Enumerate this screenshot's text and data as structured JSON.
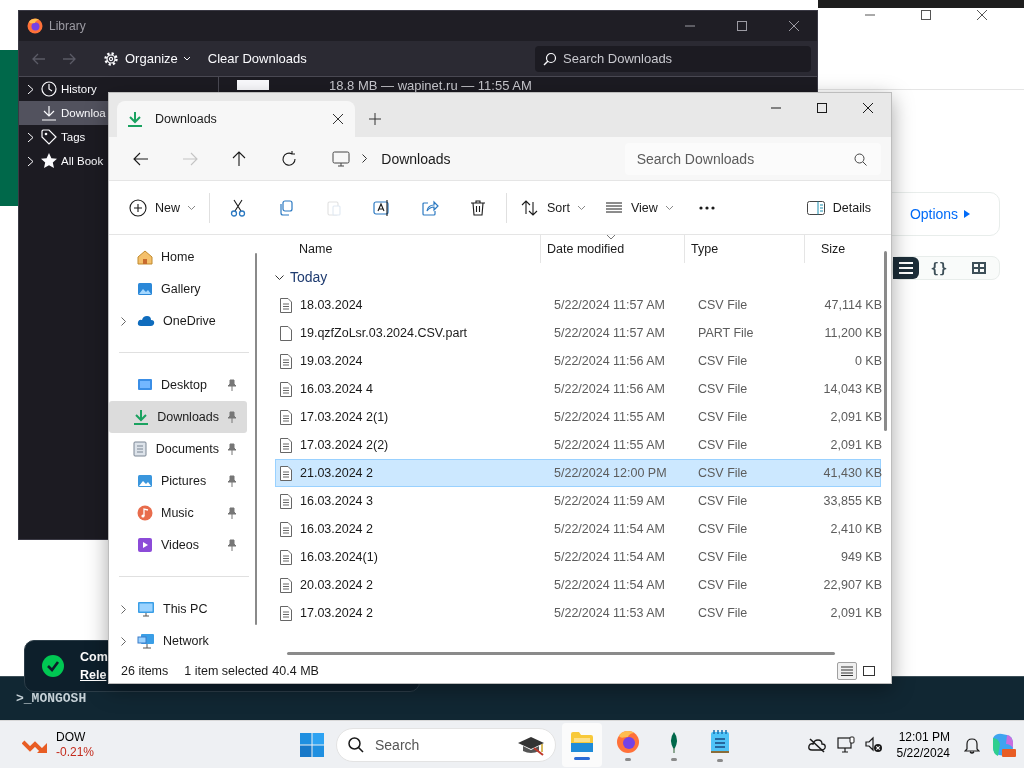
{
  "background_app": {
    "options_button": "Options",
    "view_toggle": [
      {
        "kind": "list",
        "selected": true
      },
      {
        "kind": "json",
        "label": "{}",
        "selected": false
      },
      {
        "kind": "table",
        "selected": false
      }
    ]
  },
  "terminal": {
    "prompt": ">_MONGOSH"
  },
  "toast": {
    "title": "Com",
    "link": "Rele"
  },
  "library": {
    "title": "Library",
    "nav_buttons": [
      {
        "kind": "back",
        "disabled": true
      },
      {
        "kind": "forward",
        "disabled": true
      }
    ],
    "organize": "Organize",
    "clear": "Clear Downloads",
    "search": {
      "placeholder": "Search Downloads"
    },
    "sidebar": [
      {
        "kind": "history",
        "label": "History",
        "selected": false
      },
      {
        "kind": "downloads",
        "label": "Downloa",
        "selected": true
      },
      {
        "kind": "tags",
        "label": "Tags",
        "selected": false
      },
      {
        "kind": "bookmarks",
        "label": "All Book",
        "selected": false
      }
    ],
    "downloads": [
      {
        "status": "18.8 MB — wapinet.ru — 11:55 AM"
      }
    ]
  },
  "explorer": {
    "tab": {
      "label": "Downloads",
      "selected": true
    },
    "nav_buttons": [
      {
        "kind": "back",
        "disabled": false
      },
      {
        "kind": "forward",
        "disabled": true
      },
      {
        "kind": "up",
        "disabled": false
      },
      {
        "kind": "refresh",
        "disabled": false
      }
    ],
    "breadcrumb": [
      "Downloads"
    ],
    "search": {
      "placeholder": "Search Downloads"
    },
    "commands": [
      {
        "kind": "new",
        "label": "New",
        "disabled": false
      },
      {
        "kind": "cut",
        "disabled": false
      },
      {
        "kind": "copy",
        "disabled": false
      },
      {
        "kind": "paste",
        "disabled": true
      },
      {
        "kind": "rename",
        "disabled": false
      },
      {
        "kind": "share",
        "disabled": false
      },
      {
        "kind": "delete",
        "disabled": false
      },
      {
        "kind": "sort",
        "label": "Sort",
        "disabled": false
      },
      {
        "kind": "view",
        "label": "View",
        "disabled": false
      },
      {
        "kind": "more",
        "disabled": false
      }
    ],
    "details_button": "Details",
    "nav_sections": [
      [
        {
          "kind": "home",
          "label": "Home",
          "expandable": false,
          "pinned": false,
          "selected": false
        },
        {
          "kind": "gallery",
          "label": "Gallery",
          "expandable": false,
          "pinned": false,
          "selected": false
        },
        {
          "kind": "onedrive",
          "label": "OneDrive",
          "expandable": true,
          "pinned": false,
          "selected": false
        }
      ],
      [
        {
          "kind": "desktop",
          "label": "Desktop",
          "expandable": false,
          "pinned": true,
          "selected": false
        },
        {
          "kind": "downloads",
          "label": "Downloads",
          "expandable": false,
          "pinned": true,
          "selected": true
        },
        {
          "kind": "documents",
          "label": "Documents",
          "expandable": false,
          "pinned": true,
          "selected": false
        },
        {
          "kind": "pictures",
          "label": "Pictures",
          "expandable": false,
          "pinned": true,
          "selected": false
        },
        {
          "kind": "music",
          "label": "Music",
          "expandable": false,
          "pinned": true,
          "selected": false
        },
        {
          "kind": "videos",
          "label": "Videos",
          "expandable": false,
          "pinned": true,
          "selected": false
        }
      ],
      [
        {
          "kind": "pc",
          "label": "This PC",
          "expandable": true,
          "pinned": false,
          "selected": false
        },
        {
          "kind": "network",
          "label": "Network",
          "expandable": true,
          "pinned": false,
          "selected": false
        }
      ]
    ],
    "columns": [
      "Name",
      "Date modified",
      "Type",
      "Size"
    ],
    "group": "Today",
    "rows": [
      {
        "kind": "csv",
        "name": "18.03.2024",
        "date": "5/22/2024 11:57 AM",
        "type": "CSV File",
        "size": "47,114 KB",
        "selected": false
      },
      {
        "kind": "part",
        "name": "19.qzfZoLsr.03.2024.CSV.part",
        "date": "5/22/2024 11:57 AM",
        "type": "PART File",
        "size": "11,200 KB",
        "selected": false
      },
      {
        "kind": "csv",
        "name": "19.03.2024",
        "date": "5/22/2024 11:56 AM",
        "type": "CSV File",
        "size": "0 KB",
        "selected": false
      },
      {
        "kind": "csv",
        "name": "16.03.2024 4",
        "date": "5/22/2024 11:56 AM",
        "type": "CSV File",
        "size": "14,043 KB",
        "selected": false
      },
      {
        "kind": "csv",
        "name": "17.03.2024 2(1)",
        "date": "5/22/2024 11:55 AM",
        "type": "CSV File",
        "size": "2,091 KB",
        "selected": false
      },
      {
        "kind": "csv",
        "name": "17.03.2024 2(2)",
        "date": "5/22/2024 11:55 AM",
        "type": "CSV File",
        "size": "2,091 KB",
        "selected": false
      },
      {
        "kind": "csv",
        "name": "21.03.2024 2",
        "date": "5/22/2024 12:00 PM",
        "type": "CSV File",
        "size": "41,430 KB",
        "selected": true
      },
      {
        "kind": "csv",
        "name": "16.03.2024 3",
        "date": "5/22/2024 11:59 AM",
        "type": "CSV File",
        "size": "33,855 KB",
        "selected": false
      },
      {
        "kind": "csv",
        "name": "16.03.2024 2",
        "date": "5/22/2024 11:54 AM",
        "type": "CSV File",
        "size": "2,410 KB",
        "selected": false
      },
      {
        "kind": "csv",
        "name": "16.03.2024(1)",
        "date": "5/22/2024 11:54 AM",
        "type": "CSV File",
        "size": "949 KB",
        "selected": false
      },
      {
        "kind": "csv",
        "name": "20.03.2024 2",
        "date": "5/22/2024 11:54 AM",
        "type": "CSV File",
        "size": "22,907 KB",
        "selected": false
      },
      {
        "kind": "csv",
        "name": "17.03.2024 2",
        "date": "5/22/2024 11:53 AM",
        "type": "CSV File",
        "size": "2,091 KB",
        "selected": false
      }
    ],
    "status": {
      "count": "26 items",
      "selection": "1 item selected",
      "size": "40.4 MB"
    },
    "view_modes": [
      {
        "kind": "details",
        "selected": true
      },
      {
        "kind": "tiles",
        "selected": false
      }
    ]
  },
  "taskbar": {
    "widget": {
      "name": "DOW",
      "change": "-0.21%"
    },
    "search": {
      "placeholder": "Search"
    },
    "apps": [
      {
        "kind": "explorer",
        "active": true
      },
      {
        "kind": "firefox",
        "active": false
      },
      {
        "kind": "compass",
        "active": false
      },
      {
        "kind": "notepad",
        "active": false
      }
    ],
    "time": "12:01 PM",
    "date": "5/22/2024"
  }
}
